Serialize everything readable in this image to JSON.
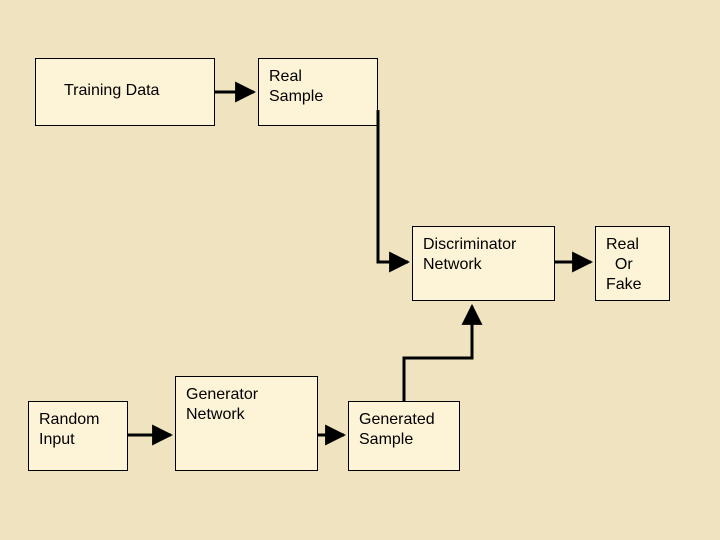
{
  "boxes": {
    "training_data": "Training Data",
    "real_sample": "Real\nSample",
    "discriminator": "Discriminator\nNetwork",
    "output": "Real\n  Or\nFake",
    "random_input": "Random\nInput",
    "generator": "Generator\nNetwork",
    "generated_sample": "Generated\nSample"
  }
}
